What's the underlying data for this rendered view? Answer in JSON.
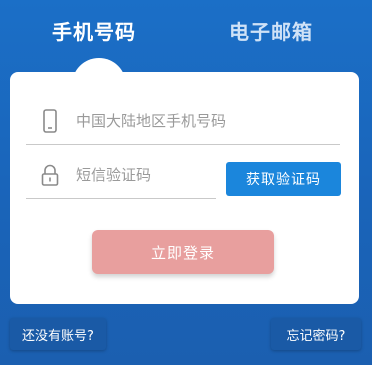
{
  "tabs": {
    "phone": "手机号码",
    "email": "电子邮箱"
  },
  "form": {
    "phone_placeholder": "中国大陆地区手机号码",
    "phone_value": "",
    "code_placeholder": "短信验证码",
    "code_value": "",
    "get_code_label": "获取验证码",
    "login_label": "立即登录"
  },
  "links": {
    "register": "还没有账号?",
    "forgot": "忘记密码?"
  },
  "icons": {
    "phone_field": "mobile-phone-icon",
    "code_field": "lock-icon"
  },
  "colors": {
    "background": "#1b6fc7",
    "get_code_button": "#1b86dc",
    "login_button": "#e89f9e",
    "link_button": "#1a5aa6"
  }
}
